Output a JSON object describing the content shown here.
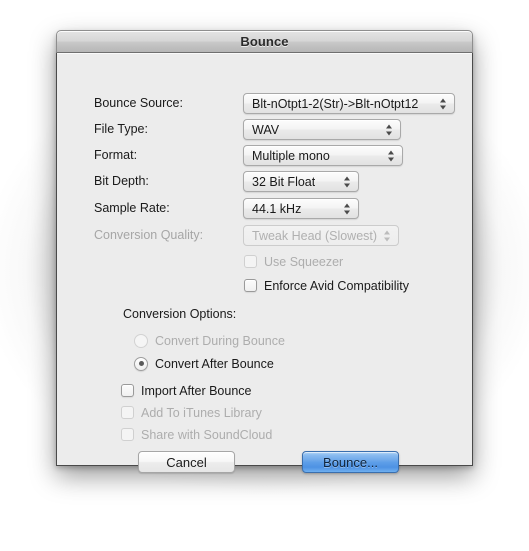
{
  "window": {
    "title": "Bounce"
  },
  "fields": [
    {
      "label": "Bounce Source:",
      "value": "Blt-nOtpt1-2(Str)->Blt-nOtpt12",
      "enabled": true
    },
    {
      "label": "File Type:",
      "value": "WAV",
      "enabled": true
    },
    {
      "label": "Format:",
      "value": "Multiple mono",
      "enabled": true
    },
    {
      "label": "Bit Depth:",
      "value": "32 Bit Float",
      "enabled": true
    },
    {
      "label": "Sample Rate:",
      "value": "44.1 kHz",
      "enabled": true
    },
    {
      "label": "Conversion Quality:",
      "value": "Tweak Head (Slowest)",
      "enabled": false
    }
  ],
  "checkboxes_top": [
    {
      "label": "Use Squeezer",
      "checked": false,
      "enabled": false
    },
    {
      "label": "Enforce Avid Compatibility",
      "checked": false,
      "enabled": true
    }
  ],
  "conversion_options": {
    "heading": "Conversion Options:",
    "radios": [
      {
        "label": "Convert During Bounce",
        "selected": false,
        "enabled": false
      },
      {
        "label": "Convert After Bounce",
        "selected": true,
        "enabled": true
      }
    ]
  },
  "checkboxes_bottom": [
    {
      "label": "Import After Bounce",
      "checked": false,
      "enabled": true
    },
    {
      "label": "Add To iTunes Library",
      "checked": false,
      "enabled": false
    },
    {
      "label": "Share with SoundCloud",
      "checked": false,
      "enabled": false
    }
  ],
  "buttons": {
    "cancel_label": "Cancel",
    "bounce_label": "Bounce...",
    "default_accent_color": "#5d9ee8"
  },
  "icons": {
    "popup_indicator": "updown-chevron-icon"
  }
}
